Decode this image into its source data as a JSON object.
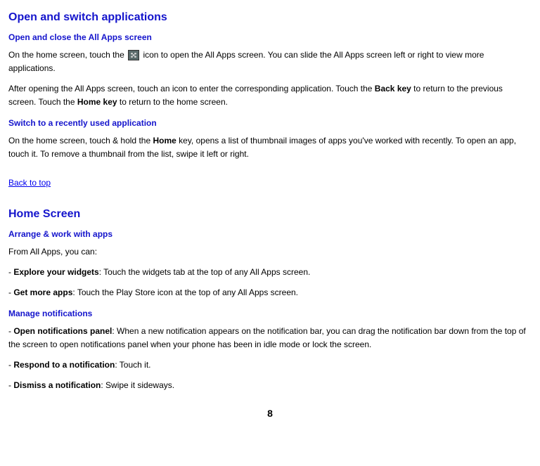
{
  "section1": {
    "title": "Open and switch applications",
    "sub1_title": "Open and close the All Apps screen",
    "sub1_p1_a": "On the home screen, touch the ",
    "sub1_p1_b": " icon to open the All Apps screen. You can slide the All Apps screen left or right to view more applications.",
    "sub1_p2_a": "After opening the All Apps screen, touch an icon to enter the corresponding application. Touch the ",
    "sub1_p2_bold1": "Back key",
    "sub1_p2_b": " to return to the previous screen. Touch the ",
    "sub1_p2_bold2": "Home key",
    "sub1_p2_c": " to return to the home screen.",
    "sub2_title": "Switch to a recently used application",
    "sub2_p1_a": "On the home screen, touch & hold the ",
    "sub2_p1_bold": "Home",
    "sub2_p1_b": " key, opens a list of thumbnail images of apps you've worked with recently. To open an app, touch it. To remove a thumbnail from the list, swipe it left or right."
  },
  "back_link": "Back to top",
  "section2": {
    "title": "Home Screen",
    "sub1_title": "Arrange & work with apps",
    "sub1_intro": "From All Apps, you can:",
    "item1_prefix": "- ",
    "item1_bold": "Explore your widgets",
    "item1_rest": ": Touch the widgets tab at the top of any All Apps screen.",
    "item2_prefix": "- ",
    "item2_bold": "Get more apps",
    "item2_rest": ": Touch the Play Store icon at the top of any All Apps screen.",
    "sub2_title": "Manage notifications",
    "item3_prefix": "- ",
    "item3_bold": "Open notifications panel",
    "item3_rest": ": When a new notification appears on the notification bar, you can drag the notification bar down from the top of the screen to open notifications panel when your phone has been in idle mode or lock the screen.",
    "item4_prefix": "- ",
    "item4_bold": "Respond to a notification",
    "item4_rest": ": Touch it.",
    "item5_prefix": "- ",
    "item5_bold": "Dismiss a notification",
    "item5_rest": ": Swipe it sideways."
  },
  "page_number": "8"
}
